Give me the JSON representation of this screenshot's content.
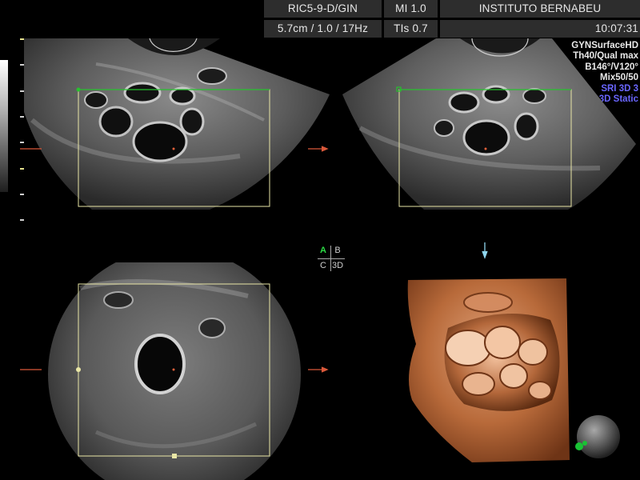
{
  "header": {
    "probe": "RIC5-9-D/GIN",
    "mi": "MI  1.0",
    "institution": "INSTITUTO BERNABEU",
    "depth_freq": "5.7cm / 1.0 / 17Hz",
    "tis": "TIs  0.7",
    "time": "10:07:31"
  },
  "side_params": {
    "mode": "GYNSurfaceHD",
    "quality": "Th40/Qual max",
    "angles": "B146°/V120°",
    "mix": "Mix50/50",
    "sri": "SRI 3D 3",
    "static": "3D Static"
  },
  "view_labels": {
    "a": "A",
    "b": "B",
    "c": "C",
    "d": "3D"
  },
  "colors": {
    "roi_box": "#e9e6a6",
    "roi_box_active": "#27c12e",
    "orient_arrow": "#d9583a",
    "down_arrow": "#8fd6ef",
    "render_skin": "#c06d3e"
  }
}
